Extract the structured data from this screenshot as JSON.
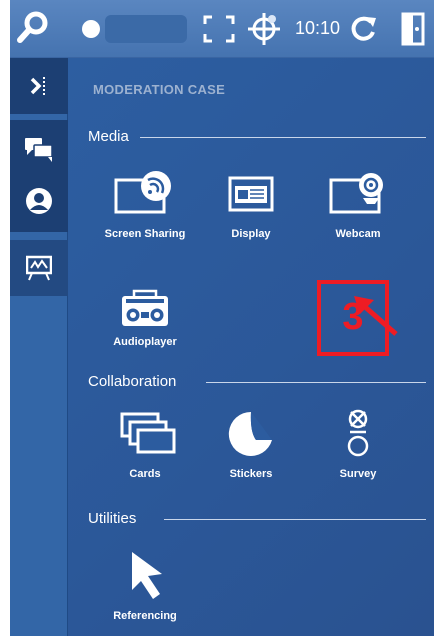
{
  "topbar": {
    "clock": "10:10",
    "icons": [
      "search-icon",
      "status-dot-icon",
      "fullscreen-icon",
      "crosshair-icon",
      "refresh-icon",
      "exit-icon"
    ]
  },
  "rail": {
    "icons": [
      "collapse-panel-icon",
      "chat-icon",
      "user-icon",
      "whiteboard-icon"
    ]
  },
  "panel": {
    "title": "MODERATION CASE",
    "sections": {
      "media": {
        "label": "Media",
        "tools": [
          "Screen Sharing",
          "Display",
          "Webcam",
          "Audioplayer"
        ]
      },
      "collaboration": {
        "label": "Collaboration",
        "tools": [
          "Cards",
          "Stickers",
          "Survey"
        ]
      },
      "utilities": {
        "label": "Utilities",
        "tools": [
          "Referencing"
        ]
      }
    }
  },
  "annotation": {
    "number": "3",
    "color": "#ee1c24"
  },
  "colors": {
    "topbar": "#4a78b4",
    "rail": "#3366a7",
    "rail_active": "#1c3f73",
    "panel": "#2b5798"
  }
}
